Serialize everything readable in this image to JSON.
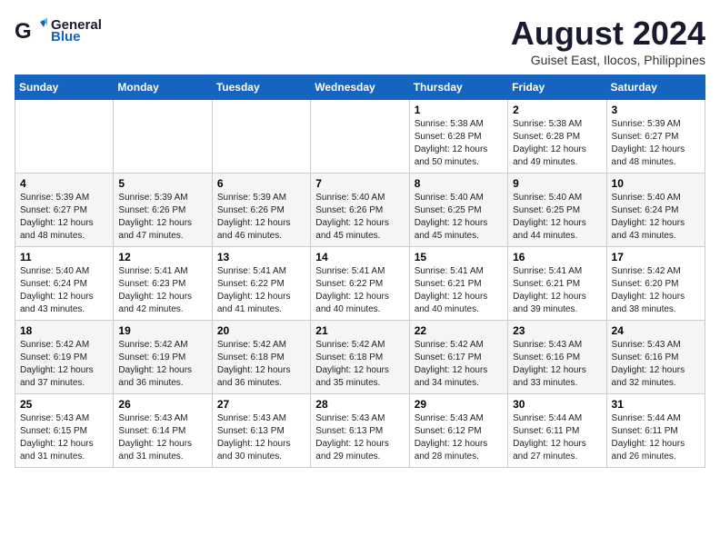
{
  "logo": {
    "general": "General",
    "blue": "Blue"
  },
  "title": {
    "month_year": "August 2024",
    "location": "Guiset East, Ilocos, Philippines"
  },
  "headers": [
    "Sunday",
    "Monday",
    "Tuesday",
    "Wednesday",
    "Thursday",
    "Friday",
    "Saturday"
  ],
  "weeks": [
    [
      {
        "day": "",
        "content": ""
      },
      {
        "day": "",
        "content": ""
      },
      {
        "day": "",
        "content": ""
      },
      {
        "day": "",
        "content": ""
      },
      {
        "day": "1",
        "content": "Sunrise: 5:38 AM\nSunset: 6:28 PM\nDaylight: 12 hours\nand 50 minutes."
      },
      {
        "day": "2",
        "content": "Sunrise: 5:38 AM\nSunset: 6:28 PM\nDaylight: 12 hours\nand 49 minutes."
      },
      {
        "day": "3",
        "content": "Sunrise: 5:39 AM\nSunset: 6:27 PM\nDaylight: 12 hours\nand 48 minutes."
      }
    ],
    [
      {
        "day": "4",
        "content": "Sunrise: 5:39 AM\nSunset: 6:27 PM\nDaylight: 12 hours\nand 48 minutes."
      },
      {
        "day": "5",
        "content": "Sunrise: 5:39 AM\nSunset: 6:26 PM\nDaylight: 12 hours\nand 47 minutes."
      },
      {
        "day": "6",
        "content": "Sunrise: 5:39 AM\nSunset: 6:26 PM\nDaylight: 12 hours\nand 46 minutes."
      },
      {
        "day": "7",
        "content": "Sunrise: 5:40 AM\nSunset: 6:26 PM\nDaylight: 12 hours\nand 45 minutes."
      },
      {
        "day": "8",
        "content": "Sunrise: 5:40 AM\nSunset: 6:25 PM\nDaylight: 12 hours\nand 45 minutes."
      },
      {
        "day": "9",
        "content": "Sunrise: 5:40 AM\nSunset: 6:25 PM\nDaylight: 12 hours\nand 44 minutes."
      },
      {
        "day": "10",
        "content": "Sunrise: 5:40 AM\nSunset: 6:24 PM\nDaylight: 12 hours\nand 43 minutes."
      }
    ],
    [
      {
        "day": "11",
        "content": "Sunrise: 5:40 AM\nSunset: 6:24 PM\nDaylight: 12 hours\nand 43 minutes."
      },
      {
        "day": "12",
        "content": "Sunrise: 5:41 AM\nSunset: 6:23 PM\nDaylight: 12 hours\nand 42 minutes."
      },
      {
        "day": "13",
        "content": "Sunrise: 5:41 AM\nSunset: 6:22 PM\nDaylight: 12 hours\nand 41 minutes."
      },
      {
        "day": "14",
        "content": "Sunrise: 5:41 AM\nSunset: 6:22 PM\nDaylight: 12 hours\nand 40 minutes."
      },
      {
        "day": "15",
        "content": "Sunrise: 5:41 AM\nSunset: 6:21 PM\nDaylight: 12 hours\nand 40 minutes."
      },
      {
        "day": "16",
        "content": "Sunrise: 5:41 AM\nSunset: 6:21 PM\nDaylight: 12 hours\nand 39 minutes."
      },
      {
        "day": "17",
        "content": "Sunrise: 5:42 AM\nSunset: 6:20 PM\nDaylight: 12 hours\nand 38 minutes."
      }
    ],
    [
      {
        "day": "18",
        "content": "Sunrise: 5:42 AM\nSunset: 6:19 PM\nDaylight: 12 hours\nand 37 minutes."
      },
      {
        "day": "19",
        "content": "Sunrise: 5:42 AM\nSunset: 6:19 PM\nDaylight: 12 hours\nand 36 minutes."
      },
      {
        "day": "20",
        "content": "Sunrise: 5:42 AM\nSunset: 6:18 PM\nDaylight: 12 hours\nand 36 minutes."
      },
      {
        "day": "21",
        "content": "Sunrise: 5:42 AM\nSunset: 6:18 PM\nDaylight: 12 hours\nand 35 minutes."
      },
      {
        "day": "22",
        "content": "Sunrise: 5:42 AM\nSunset: 6:17 PM\nDaylight: 12 hours\nand 34 minutes."
      },
      {
        "day": "23",
        "content": "Sunrise: 5:43 AM\nSunset: 6:16 PM\nDaylight: 12 hours\nand 33 minutes."
      },
      {
        "day": "24",
        "content": "Sunrise: 5:43 AM\nSunset: 6:16 PM\nDaylight: 12 hours\nand 32 minutes."
      }
    ],
    [
      {
        "day": "25",
        "content": "Sunrise: 5:43 AM\nSunset: 6:15 PM\nDaylight: 12 hours\nand 31 minutes."
      },
      {
        "day": "26",
        "content": "Sunrise: 5:43 AM\nSunset: 6:14 PM\nDaylight: 12 hours\nand 31 minutes."
      },
      {
        "day": "27",
        "content": "Sunrise: 5:43 AM\nSunset: 6:13 PM\nDaylight: 12 hours\nand 30 minutes."
      },
      {
        "day": "28",
        "content": "Sunrise: 5:43 AM\nSunset: 6:13 PM\nDaylight: 12 hours\nand 29 minutes."
      },
      {
        "day": "29",
        "content": "Sunrise: 5:43 AM\nSunset: 6:12 PM\nDaylight: 12 hours\nand 28 minutes."
      },
      {
        "day": "30",
        "content": "Sunrise: 5:44 AM\nSunset: 6:11 PM\nDaylight: 12 hours\nand 27 minutes."
      },
      {
        "day": "31",
        "content": "Sunrise: 5:44 AM\nSunset: 6:11 PM\nDaylight: 12 hours\nand 26 minutes."
      }
    ]
  ]
}
